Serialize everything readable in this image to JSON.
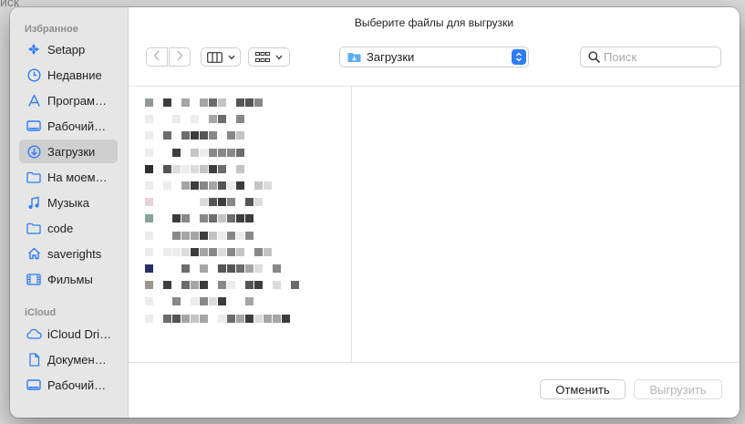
{
  "dialog": {
    "title": "Выберите файлы для выгрузки"
  },
  "sidebar": {
    "favorites_title": "Избранное",
    "favorites": [
      {
        "label": "Setapp",
        "icon": "setapp-icon"
      },
      {
        "label": "Недавние",
        "icon": "clock-icon"
      },
      {
        "label": "Програм…",
        "icon": "applications-icon"
      },
      {
        "label": "Рабочий…",
        "icon": "desktop-icon"
      },
      {
        "label": "Загрузки",
        "icon": "download-icon",
        "active": true
      },
      {
        "label": "На моем…",
        "icon": "folder-icon"
      },
      {
        "label": "Музыка",
        "icon": "music-icon"
      },
      {
        "label": "code",
        "icon": "folder-icon"
      },
      {
        "label": "saverights",
        "icon": "home-icon"
      },
      {
        "label": "Фильмы",
        "icon": "film-icon"
      }
    ],
    "icloud_title": "iCloud",
    "icloud": [
      {
        "label": "iCloud Dri…",
        "icon": "cloud-icon"
      },
      {
        "label": "Докумен…",
        "icon": "document-icon"
      },
      {
        "label": "Рабочий…",
        "icon": "desktop-icon"
      }
    ]
  },
  "toolbar": {
    "location": "Загрузки",
    "search_placeholder": "Поиск"
  },
  "buttons": {
    "cancel": "Отменить",
    "upload": "Выгрузить"
  },
  "colors": {
    "accent": "#2f7cf6",
    "icon_blue": "#2d7df6"
  }
}
